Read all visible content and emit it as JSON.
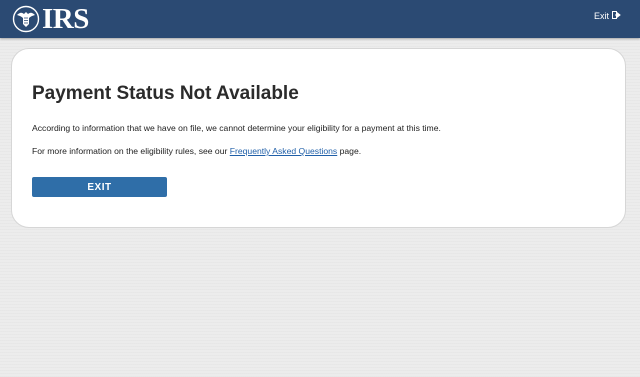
{
  "header": {
    "logo_text": "IRS",
    "exit_label": "Exit",
    "exit_icon": "exit-arrow-icon"
  },
  "card": {
    "title": "Payment Status Not Available",
    "paragraph1": "According to information that we have on file, we cannot determine your eligibility for a payment at this time.",
    "paragraph2_before": "For more information on the eligibility rules, see our ",
    "faq_link": "Frequently Asked Questions",
    "paragraph2_after": " page.",
    "exit_button": "EXIT"
  },
  "colors": {
    "header_bg": "#2b4a73",
    "button_bg": "#2f6ea8",
    "link": "#1f5fa8",
    "page_bg": "#ececec"
  }
}
